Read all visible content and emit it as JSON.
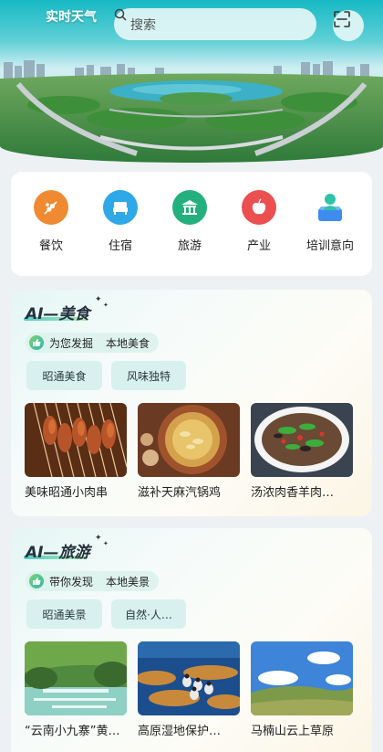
{
  "header": {
    "weather_label": "实时天气",
    "search_placeholder": "搜索",
    "search_icon": "search-icon",
    "scan_icon": "scan-icon"
  },
  "categories": [
    {
      "label": "餐饮",
      "icon": "food-skewer-icon",
      "color": "#f08a32"
    },
    {
      "label": "住宿",
      "icon": "bed-icon",
      "color": "#2fa8e8"
    },
    {
      "label": "旅游",
      "icon": "temple-icon",
      "color": "#24b07e"
    },
    {
      "label": "产业",
      "icon": "apple-icon",
      "color": "#ec4f4f"
    },
    {
      "label": "培训意向",
      "icon": "training-user-icon",
      "color": "#3e8cf0"
    }
  ],
  "food_section": {
    "title": "AI—美食",
    "discover_prefix": "为您发掘",
    "discover_text": "本地美食",
    "chips": [
      "昭通美食",
      "风味独特"
    ],
    "items": [
      {
        "caption": "美味昭通小肉串"
      },
      {
        "caption": "滋补天麻汽锅鸡"
      },
      {
        "caption": "汤浓肉香羊肉…"
      }
    ]
  },
  "travel_section": {
    "title": "AI—旅游",
    "discover_prefix": "带你发现",
    "discover_text": "本地美景",
    "chips": [
      "昭通美景",
      "自然·人…"
    ],
    "items": [
      {
        "caption": "“云南小九寨”黄…"
      },
      {
        "caption": "高原湿地保护…"
      },
      {
        "caption": "马楠山云上草原"
      }
    ]
  }
}
